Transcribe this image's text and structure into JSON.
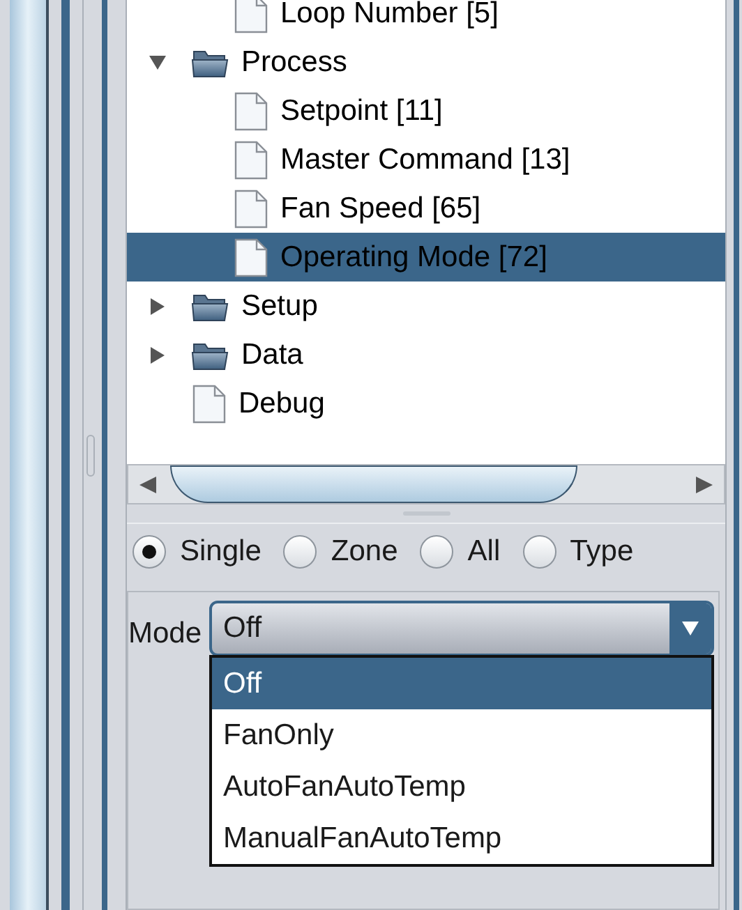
{
  "tree": {
    "cut_branch": [
      {
        "kind": "leaf",
        "label": "Loop Number [5]",
        "selected": false
      }
    ],
    "items": [
      {
        "kind": "folder",
        "label": "Process",
        "expanded": true,
        "selected": false,
        "children": [
          {
            "kind": "leaf",
            "label": "Setpoint [11]",
            "selected": false
          },
          {
            "kind": "leaf",
            "label": "Master Command [13]",
            "selected": false
          },
          {
            "kind": "leaf",
            "label": "Fan Speed [65]",
            "selected": false
          },
          {
            "kind": "leaf",
            "label": "Operating Mode [72]",
            "selected": true
          }
        ]
      },
      {
        "kind": "folder",
        "label": "Setup",
        "expanded": false,
        "selected": false
      },
      {
        "kind": "folder",
        "label": "Data",
        "expanded": false,
        "selected": false
      },
      {
        "kind": "leaf",
        "label": "Debug",
        "selected": false
      }
    ]
  },
  "scope_options": [
    {
      "label": "Single",
      "selected": true
    },
    {
      "label": "Zone",
      "selected": false
    },
    {
      "label": "All",
      "selected": false
    },
    {
      "label": "Type",
      "selected": false
    }
  ],
  "mode": {
    "label": "Mode",
    "value": "Off",
    "expanded": true,
    "options": [
      {
        "label": "Off",
        "selected": true
      },
      {
        "label": "FanOnly",
        "selected": false
      },
      {
        "label": "AutoFanAutoTemp",
        "selected": false
      },
      {
        "label": "ManualFanAutoTemp",
        "selected": false
      }
    ]
  }
}
